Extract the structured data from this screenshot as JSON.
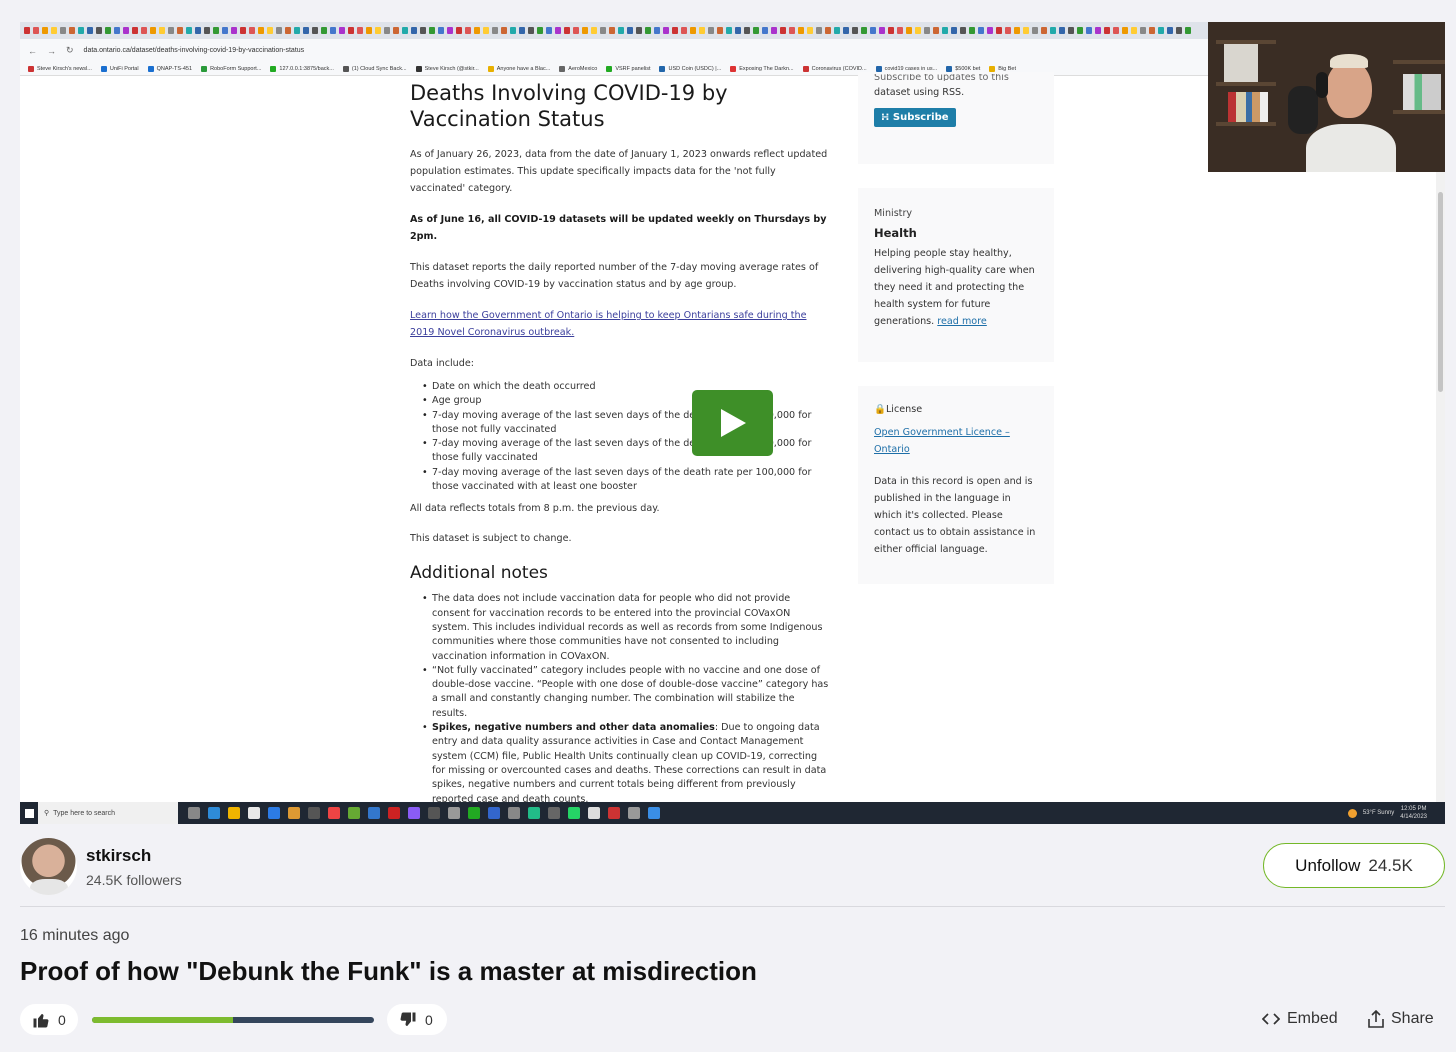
{
  "video": {
    "url": "data.ontario.ca/dataset/deaths-involving-covid-19-by-vaccination-status",
    "bookmarks": [
      "Steve Kirsch's newsl...",
      "UniFi Portal",
      "QNAP-TS-451",
      "RoboForm Support...",
      "127.0.0.1:3875/back...",
      "(1) Cloud Sync Back...",
      "Steve Kirsch (@stkir...",
      "Anyone have a Blac...",
      "AeroMexico",
      "VSRF panelist",
      "USD Coin (USDC) |...",
      "Exposing The Darkn...",
      "Coronavirus (COVID...",
      "covid19 cases in us...",
      "$500K bet",
      "Big Bet"
    ],
    "page": {
      "title": "Deaths Involving COVID-19 by Vaccination Status",
      "p1": "As of January 26, 2023, data from the date of January 1, 2023 onwards reflect updated population estimates. This update specifically impacts data for the 'not fully vaccinated' category.",
      "p2": "As of June 16, all COVID-19 datasets will be updated weekly on Thursdays by 2pm.",
      "p3": "This dataset reports the daily reported number of the 7-day moving average rates of Deaths involving COVID-19 by vaccination status and by age group.",
      "link": "Learn how the Government of Ontario is helping to keep Ontarians safe during the 2019 Novel Coronavirus outbreak.",
      "data_include": "Data include:",
      "items": [
        "Date on which the death occurred",
        "Age group",
        "7-day moving average of the last seven days of the death rate per 100,000 for those not fully vaccinated",
        "7-day moving average of the last seven days of the death rate per 100,000 for those fully vaccinated",
        "7-day moving average of the last seven days of the death rate per 100,000 for those vaccinated with at least one booster"
      ],
      "p4": "All data reflects totals from 8 p.m. the previous day.",
      "p5": "This dataset is subject to change.",
      "notes_title": "Additional notes",
      "note1": "The data does not include vaccination data for people who did not provide consent for vaccination records to be entered into the provincial COVaxON system. This includes individual records as well as records from some Indigenous communities where those communities have not consented to including vaccination information in COVaxON.",
      "note2": "“Not fully vaccinated” category includes people with no vaccine and one dose of double-dose vaccine. “People with one dose of double-dose vaccine” category has a small and constantly changing number. The combination will stabilize the results.",
      "note3_bold": "Spikes, negative numbers and other data anomalies",
      "note3": ": Due to ongoing data entry and data quality assurance activities in Case and Contact Management system (CCM) file, Public Health Units continually clean up COVID-19, correcting for missing or overcounted cases and deaths. These corrections can result in data spikes, negative numbers and current totals being different from previously reported case and death counts."
    },
    "sidebar": {
      "cut_text": "Subscribe to updates to this",
      "rss_text": "dataset using RSS.",
      "subscribe": "Subscribe",
      "ministry_label": "Ministry",
      "ministry_name": "Health",
      "ministry_desc": "Helping people stay healthy, delivering high-quality care when they need it and protecting the health system for future generations.",
      "read_more": "read more",
      "license_label": "License",
      "license_link": "Open Government Licence – Ontario",
      "license_desc": "Data in this record is open and is published in the language in which it's collected. Please contact us to obtain assistance in either official language."
    },
    "taskbar": {
      "search": "Type here to search",
      "weather": "53°F  Sunny",
      "time": "12:05 PM",
      "date": "4/14/2023"
    }
  },
  "author": {
    "name": "stkirsch",
    "followers": "24.5K followers"
  },
  "unfollow": {
    "label": "Unfollow",
    "count": "24.5K"
  },
  "post": {
    "time": "16 minutes ago",
    "title": "Proof of how \"Debunk the Funk\" is a master at misdirection"
  },
  "votes": {
    "up": "0",
    "down": "0",
    "ratio": 0.5
  },
  "actions": {
    "embed": "Embed",
    "share": "Share"
  },
  "colors": {
    "accent_green": "#74b828",
    "play_green": "#3e8f28"
  }
}
